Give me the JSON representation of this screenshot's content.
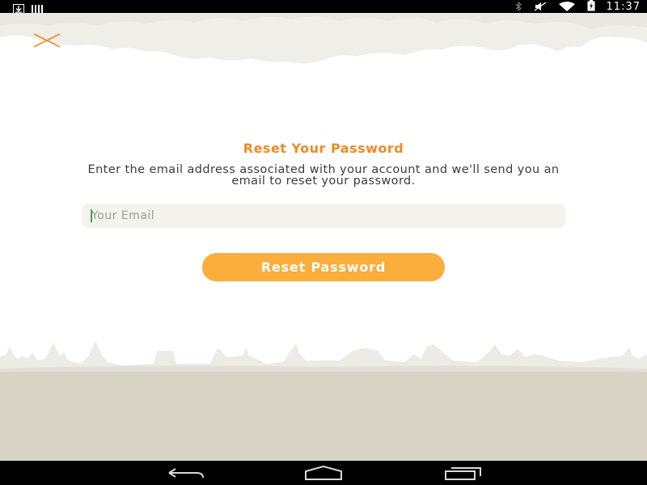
{
  "status_bar": {
    "time": "11:37",
    "icons": [
      "download-icon",
      "bars-icon",
      "bluetooth-icon",
      "mute-icon",
      "wifi-icon",
      "battery-charging-icon"
    ]
  },
  "reset": {
    "title": "Reset Your Password",
    "description": "Enter the email address associated with your account and we'll send you an email to reset your password.",
    "email_placeholder": "Your Email",
    "email_value": "",
    "button_label": "Reset Password"
  },
  "nav_bar": {
    "icons": [
      "back-icon",
      "home-icon",
      "recents-icon"
    ]
  },
  "colors": {
    "accent_orange": "#ef8a25",
    "button_orange": "#fbae3c",
    "cloud": "#efeee9",
    "ground": "#d7d4c6"
  }
}
